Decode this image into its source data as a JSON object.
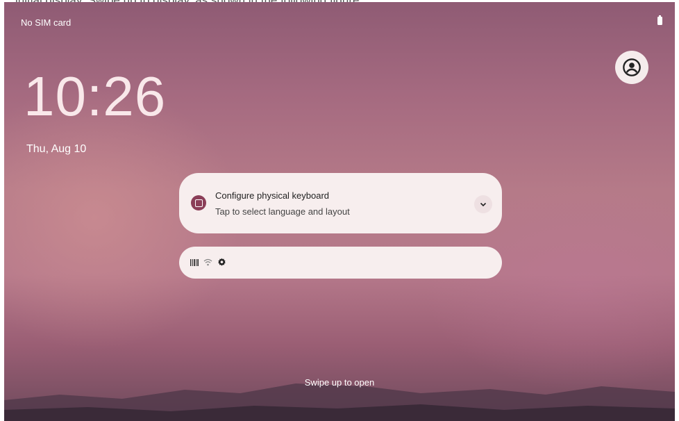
{
  "caption": "initial display. Swipe up to display, as shown in the following figure",
  "status_bar": {
    "carrier": "No SIM card",
    "battery_icon": "battery-icon"
  },
  "user_icon": "account-circle-icon",
  "clock": {
    "time": "10:26",
    "date": "Thu, Aug 10"
  },
  "notification": {
    "title": "Configure physical keyboard",
    "subtitle": "Tap to select language and layout",
    "app_icon": "keyboard-app-icon",
    "expand_icon": "chevron-down-icon"
  },
  "silent_bar": {
    "icons": [
      "barcode-icon",
      "wifi-icon",
      "settings-icon"
    ]
  },
  "hint": "Swipe up to open"
}
